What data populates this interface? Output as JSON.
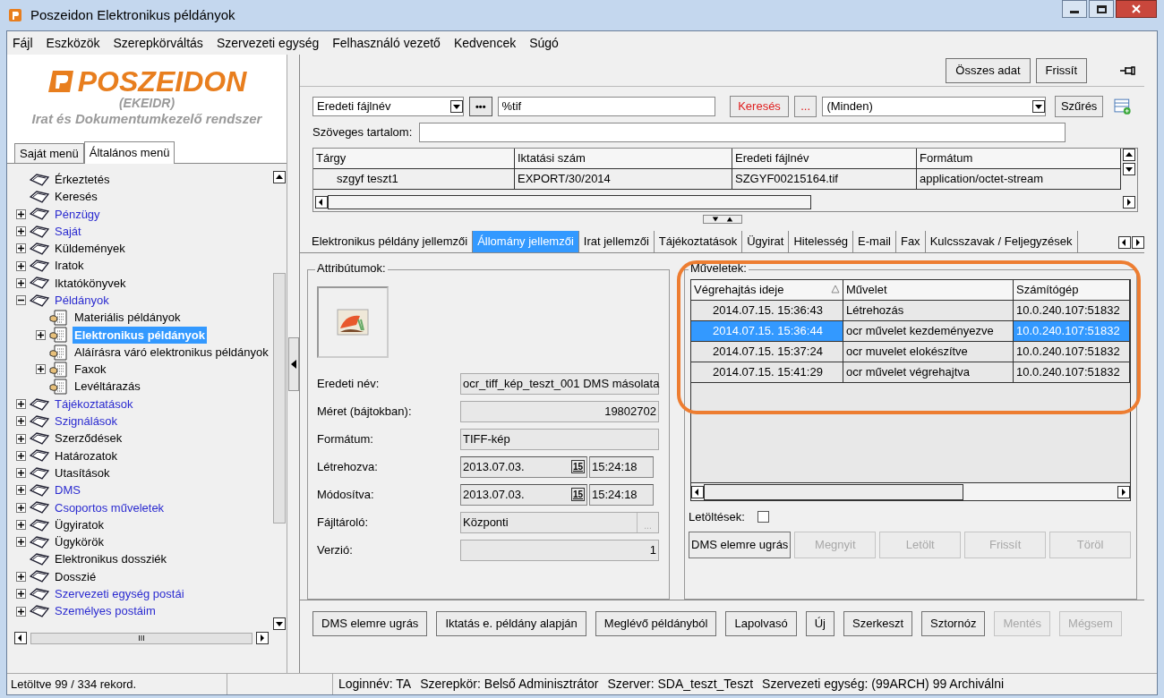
{
  "window": {
    "title": "Poszeidon Elektronikus példányok"
  },
  "menu": [
    "Fájl",
    "Eszközök",
    "Szerepkörváltás",
    "Szervezeti egység",
    "Felhasználó vezető",
    "Kedvencek",
    "Súgó"
  ],
  "logo": {
    "name": "POSZEIDON",
    "subtitle": "(EKEIDR)",
    "tagline": "Irat és Dokumentumkezelő rendszer"
  },
  "menu_tabs": [
    {
      "label": "Saját menü",
      "selected": false
    },
    {
      "label": "Általános menü",
      "selected": true
    }
  ],
  "tree": [
    {
      "label": "Érkeztetés",
      "kind": "plain",
      "selected": false
    },
    {
      "label": "Keresés",
      "kind": "plain",
      "selected": false
    },
    {
      "label": "Pénzügy",
      "kind": "module",
      "expanded": false,
      "selected": false
    },
    {
      "label": "Saját",
      "kind": "module",
      "expanded": false,
      "selected": false
    },
    {
      "label": "Küldemények",
      "kind": "plain",
      "expanded": false,
      "selected": false
    },
    {
      "label": "Iratok",
      "kind": "plain",
      "expanded": false,
      "selected": false
    },
    {
      "label": "Iktatókönyvek",
      "kind": "plain",
      "expanded": false,
      "selected": false
    },
    {
      "label": "Példányok",
      "kind": "module",
      "expanded": true,
      "selected": false,
      "children": [
        {
          "label": "Materiális példányok",
          "kind": "plain",
          "selected": false
        },
        {
          "label": "Elektronikus példányok",
          "kind": "plain",
          "expanded": false,
          "selected": true
        },
        {
          "label": "Aláírásra váró elektronikus példányok",
          "kind": "plain",
          "selected": false
        },
        {
          "label": "Faxok",
          "kind": "plain",
          "expanded": false,
          "selected": false
        },
        {
          "label": "Levéltárazás",
          "kind": "plain",
          "selected": false
        }
      ]
    },
    {
      "label": "Tájékoztatások",
      "kind": "module",
      "expanded": false,
      "selected": false
    },
    {
      "label": "Szignálások",
      "kind": "module",
      "expanded": false,
      "selected": false
    },
    {
      "label": "Szerződések",
      "kind": "plain",
      "expanded": false,
      "selected": false
    },
    {
      "label": "Határozatok",
      "kind": "plain",
      "expanded": false,
      "selected": false
    },
    {
      "label": "Utasítások",
      "kind": "plain",
      "expanded": false,
      "selected": false
    },
    {
      "label": "DMS",
      "kind": "module",
      "expanded": false,
      "selected": false
    },
    {
      "label": "Csoportos műveletek",
      "kind": "module",
      "expanded": false,
      "selected": false
    },
    {
      "label": "Ügyiratok",
      "kind": "plain",
      "expanded": false,
      "selected": false
    },
    {
      "label": "Ügykörök",
      "kind": "plain",
      "expanded": false,
      "selected": false
    },
    {
      "label": "Elektronikus dossziék",
      "kind": "plain",
      "selected": false
    },
    {
      "label": "Dosszié",
      "kind": "plain",
      "expanded": false,
      "selected": false
    },
    {
      "label": "Szervezeti egység postái",
      "kind": "module",
      "expanded": false,
      "selected": false
    },
    {
      "label": "Személyes postáim",
      "kind": "module",
      "expanded": false,
      "selected": false
    }
  ],
  "scroll_grip": "III",
  "toolbar": {
    "buttons": [
      "Összes adat",
      "Frissít"
    ]
  },
  "filter": {
    "field": "Eredeti fájlnév",
    "more": "•••",
    "value": "%tif",
    "search": "Keresés",
    "dots": "...",
    "scope": "(Minden)",
    "apply": "Szűrés",
    "content_label": "Szöveges tartalom:"
  },
  "results": {
    "columns": [
      "Tárgy",
      "Iktatási szám",
      "Eredeti fájlnév",
      "Formátum"
    ],
    "rows": [
      [
        "szgyf teszt1",
        "EXPORT/30/2014",
        "SZGYF00215164.tif",
        "application/octet-stream"
      ]
    ]
  },
  "detail_tabs": [
    {
      "label": "Elektronikus példány jellemzői",
      "selected": false
    },
    {
      "label": "Állomány jellemzői",
      "selected": true
    },
    {
      "label": "Irat jellemzői",
      "selected": false
    },
    {
      "label": "Tájékoztatások",
      "selected": false
    },
    {
      "label": "Ügyirat",
      "selected": false
    },
    {
      "label": "Hitelesség",
      "selected": false
    },
    {
      "label": "E-mail",
      "selected": false
    },
    {
      "label": "Fax",
      "selected": false
    },
    {
      "label": "Kulcsszavak / Feljegyzések",
      "selected": false
    }
  ],
  "attributes": {
    "title": "Attribútumok:",
    "fields": [
      {
        "label": "Eredeti név:",
        "kind": "text",
        "value": "ocr_tiff_kép_teszt_001 DMS másolata"
      },
      {
        "label": "Méret (bájtokban):",
        "kind": "number",
        "value": "19802702"
      },
      {
        "label": "Formátum:",
        "kind": "text",
        "value": "TIFF-kép"
      },
      {
        "label": "Létrehozva:",
        "kind": "datetime",
        "value": "2013.07.03.",
        "time": "15:24:18",
        "calendar": "15"
      },
      {
        "label": "Módosítva:",
        "kind": "datetime",
        "value": "2013.07.03.",
        "time": "15:24:18",
        "calendar": "15"
      },
      {
        "label": "Fájltároló:",
        "kind": "picker",
        "value": "Központi",
        "button": "..."
      },
      {
        "label": "Verzió:",
        "kind": "number",
        "value": "1"
      }
    ]
  },
  "operations": {
    "title": "Műveletek:",
    "columns": [
      "Végrehajtás ideje",
      "Művelet",
      "Számítógép"
    ],
    "rows": [
      {
        "cells": [
          "2014.07.15. 15:36:43",
          "Létrehozás",
          "10.0.240.107:51832"
        ],
        "selected": false
      },
      {
        "cells": [
          "2014.07.15. 15:36:44",
          "ocr művelet kezdeményezve",
          "10.0.240.107:51832"
        ],
        "selected": true
      },
      {
        "cells": [
          "2014.07.15. 15:37:24",
          "ocr muvelet elokészítve",
          "10.0.240.107:51832"
        ],
        "selected": false
      },
      {
        "cells": [
          "2014.07.15. 15:41:29",
          "ocr művelet végrehajtva",
          "10.0.240.107:51832"
        ],
        "selected": false
      }
    ],
    "downloads_label": "Letöltések:",
    "downloads_checked": false,
    "buttons": [
      {
        "label": "DMS elemre ugrás",
        "disabled": false
      },
      {
        "label": "Megnyit",
        "disabled": true
      },
      {
        "label": "Letölt",
        "disabled": true
      },
      {
        "label": "Frissít",
        "disabled": true
      },
      {
        "label": "Töröl",
        "disabled": true
      }
    ]
  },
  "actions": [
    {
      "label": "DMS elemre ugrás",
      "disabled": false
    },
    {
      "label": "Iktatás e. példány alapján",
      "disabled": false
    },
    {
      "label": "Meglévő példányból",
      "disabled": false
    },
    {
      "label": "Lapolvasó",
      "disabled": false
    },
    {
      "label": "Új",
      "disabled": false
    },
    {
      "label": "Szerkeszt",
      "disabled": false
    },
    {
      "label": "Sztornóz",
      "disabled": false
    },
    {
      "label": "Mentés",
      "disabled": true
    },
    {
      "label": "Mégsem",
      "disabled": true
    }
  ],
  "status_bar": {
    "records": "Letöltve 99 / 334 rekord.",
    "session": [
      "Loginnév: TA",
      "Szerepkör: Belső Adminisztrátor",
      "Szerver: SDA_teszt_Teszt",
      "Szervezeti egység: (99ARCH) 99 Archiválni"
    ]
  }
}
